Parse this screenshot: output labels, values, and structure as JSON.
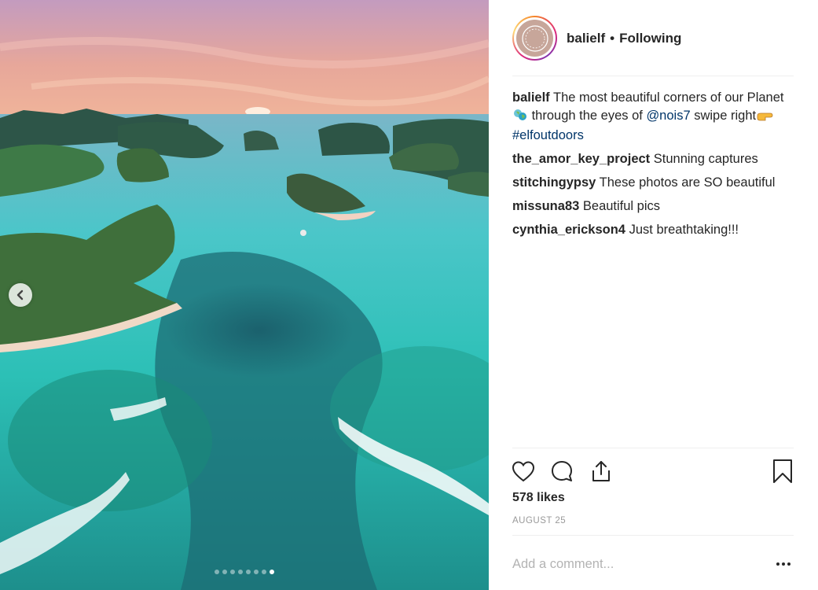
{
  "post": {
    "username": "balielf",
    "separator": "•",
    "follow_status": "Following",
    "avatar_text": "ELF"
  },
  "carousel": {
    "slide_count": 8,
    "active_index": 7
  },
  "caption": {
    "username": "balielf",
    "text_1": "The most beautiful corners of our Planet",
    "emoji_1": "earth-emoji",
    "text_2": " through the eyes of ",
    "mention": "@nois7",
    "text_3": " swipe right",
    "emoji_2": "pointing-hand-emoji",
    "hashtag": "#elfoutdoors"
  },
  "comments": [
    {
      "username": "the_amor_key_project",
      "text": "Stunning captures"
    },
    {
      "username": "stitchingypsy",
      "text": "These photos are SO beautiful"
    },
    {
      "username": "missuna83",
      "text": "Beautiful pics"
    },
    {
      "username": "cynthia_erickson4",
      "text": "Just breathtaking!!!"
    }
  ],
  "likes": "578 likes",
  "date": "AUGUST 25",
  "add_comment": {
    "placeholder": "Add a comment..."
  },
  "icons": {
    "like": "heart-icon",
    "comment": "comment-icon",
    "share": "share-icon",
    "save": "bookmark-icon",
    "prev": "chevron-left-icon",
    "more": "more-options-icon"
  }
}
